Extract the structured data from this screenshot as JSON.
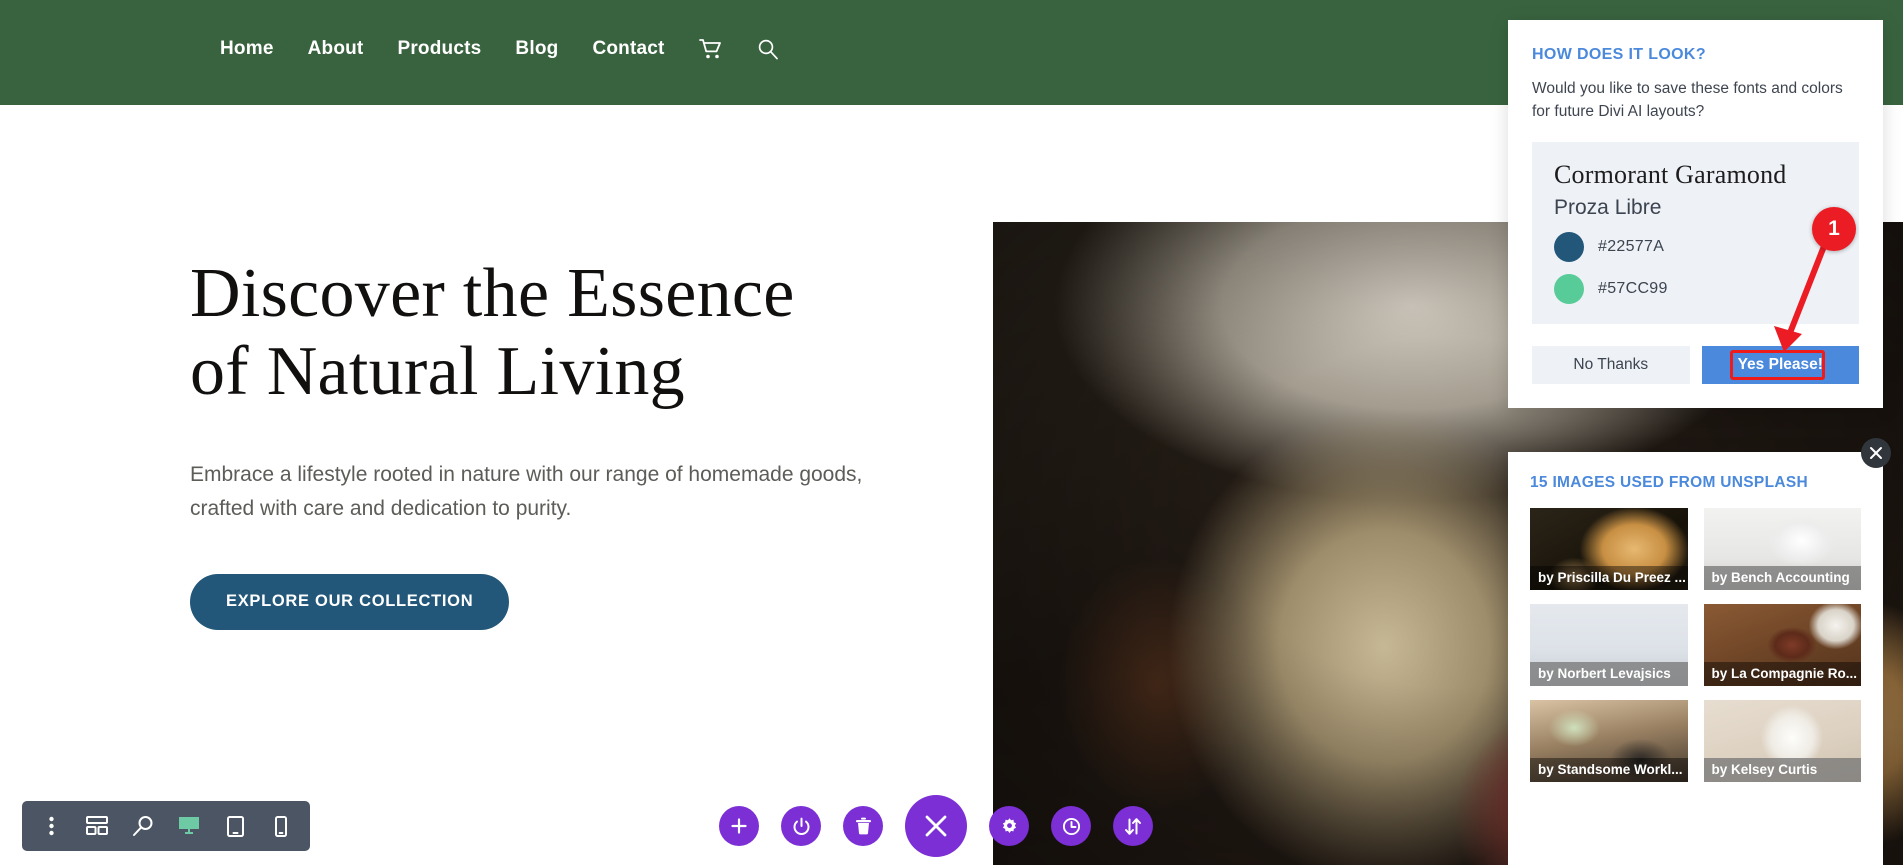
{
  "site": {
    "nav": {
      "links": [
        {
          "label": "Home"
        },
        {
          "label": "About"
        },
        {
          "label": "Products"
        },
        {
          "label": "Blog"
        },
        {
          "label": "Contact"
        }
      ],
      "cart_icon": "shopping-cart-icon",
      "search_icon": "search-icon"
    },
    "hero": {
      "title_line1": "Discover the Essence",
      "title_line2": "of Natural Living",
      "subtitle": "Embrace a lifestyle rooted in nature with our range of homemade goods, crafted with care and dedication to purity.",
      "cta_label": "EXPLORE OUR COLLECTION",
      "cta_color": "#22577A"
    },
    "header_color": "#39633F"
  },
  "builder": {
    "left_tools": [
      {
        "name": "more-options-icon",
        "active": false
      },
      {
        "name": "wireframe-view-icon",
        "active": false
      },
      {
        "name": "zoom-out-icon",
        "active": false
      },
      {
        "name": "desktop-view-icon",
        "active": true
      },
      {
        "name": "tablet-view-icon",
        "active": false
      },
      {
        "name": "phone-view-icon",
        "active": false
      }
    ],
    "center_tools": [
      {
        "name": "add-section-icon"
      },
      {
        "name": "power-toggle-icon"
      },
      {
        "name": "trash-icon"
      },
      {
        "name": "close-builder-icon"
      },
      {
        "name": "settings-gear-icon"
      },
      {
        "name": "history-clock-icon"
      },
      {
        "name": "sort-arrows-icon"
      }
    ],
    "accent_color": "#7B2FD4"
  },
  "look_panel": {
    "title": "HOW DOES IT LOOK?",
    "description": "Would you like to save these fonts and colors for future Divi AI layouts?",
    "preview": {
      "heading_font": "Cormorant Garamond",
      "body_font": "Proza Libre",
      "colors": [
        {
          "hex": "#22577A"
        },
        {
          "hex": "#57CC99"
        }
      ]
    },
    "buttons": {
      "secondary": "No Thanks",
      "primary": "Yes Please!"
    },
    "accent_color": "#4B89DC"
  },
  "annotation": {
    "step_number": "1",
    "color": "#EC1C24"
  },
  "unsplash_panel": {
    "title": "15 IMAGES USED FROM UNSPLASH",
    "close_icon": "close-icon",
    "images": [
      {
        "credit": "by Priscilla Du Preez ...",
        "tone": "dark",
        "art": "t1"
      },
      {
        "credit": "by Bench Accounting",
        "tone": "light",
        "art": "t2"
      },
      {
        "credit": "by Norbert Levajsics",
        "tone": "light",
        "art": "t3"
      },
      {
        "credit": "by La Compagnie Ro...",
        "tone": "dark",
        "art": "t4"
      },
      {
        "credit": "by Standsome Workl...",
        "tone": "dark",
        "art": "t5"
      },
      {
        "credit": "by Kelsey Curtis",
        "tone": "light",
        "art": "t6"
      }
    ]
  }
}
